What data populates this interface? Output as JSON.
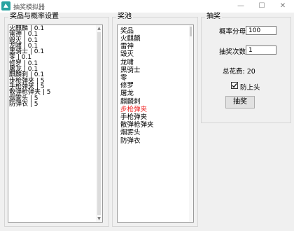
{
  "window": {
    "title": "抽奖模拟器",
    "minimize_glyph": "—",
    "maximize_glyph": "☐",
    "close_glyph": "✕"
  },
  "prizes_group": {
    "label": "奖品与概率设置",
    "lines": [
      "火麒麟 | 0.1",
      "雷神 | 0.1",
      "毁灭 | 0.1",
      "龙啸 | 0.1",
      "黑骑士 | 0.1",
      "零 | 0.1",
      "修罗 | 0.1",
      "屠龙 | 0.1",
      "麒麟刺 | 0.1",
      "步枪弹夹 | 5",
      "手枪弹夹 | 5",
      "散弹枪弹夹 | 5",
      "烟雾头 | 5",
      "防弹衣 | 5"
    ]
  },
  "pool_group": {
    "label": "奖池",
    "header": "奖品",
    "items": [
      {
        "text": "火麒麟",
        "highlight": false
      },
      {
        "text": "雷神",
        "highlight": false
      },
      {
        "text": "毁灭",
        "highlight": false
      },
      {
        "text": "龙啸",
        "highlight": false
      },
      {
        "text": "黑骑士",
        "highlight": false
      },
      {
        "text": "零",
        "highlight": false
      },
      {
        "text": "修罗",
        "highlight": false
      },
      {
        "text": "屠龙",
        "highlight": false
      },
      {
        "text": "麒麟刺",
        "highlight": false
      },
      {
        "text": "步枪弹夹",
        "highlight": true
      },
      {
        "text": "手枪弹夹",
        "highlight": false
      },
      {
        "text": "散弹枪弹夹",
        "highlight": false
      },
      {
        "text": "烟雾头",
        "highlight": false
      },
      {
        "text": "防弹衣",
        "highlight": false
      }
    ]
  },
  "draw_group": {
    "label": "抽奖",
    "denominator_label": "概率分母号:",
    "denominator_value": "100",
    "count_label": "抽奖次数:",
    "count_value": "1",
    "total_cost": "总花费: 20",
    "anti_head_label": "防上头",
    "anti_head_checked": true,
    "draw_button": "抽奖"
  },
  "colors": {
    "highlight": "#e22222",
    "icon": "#2aa3a0"
  }
}
